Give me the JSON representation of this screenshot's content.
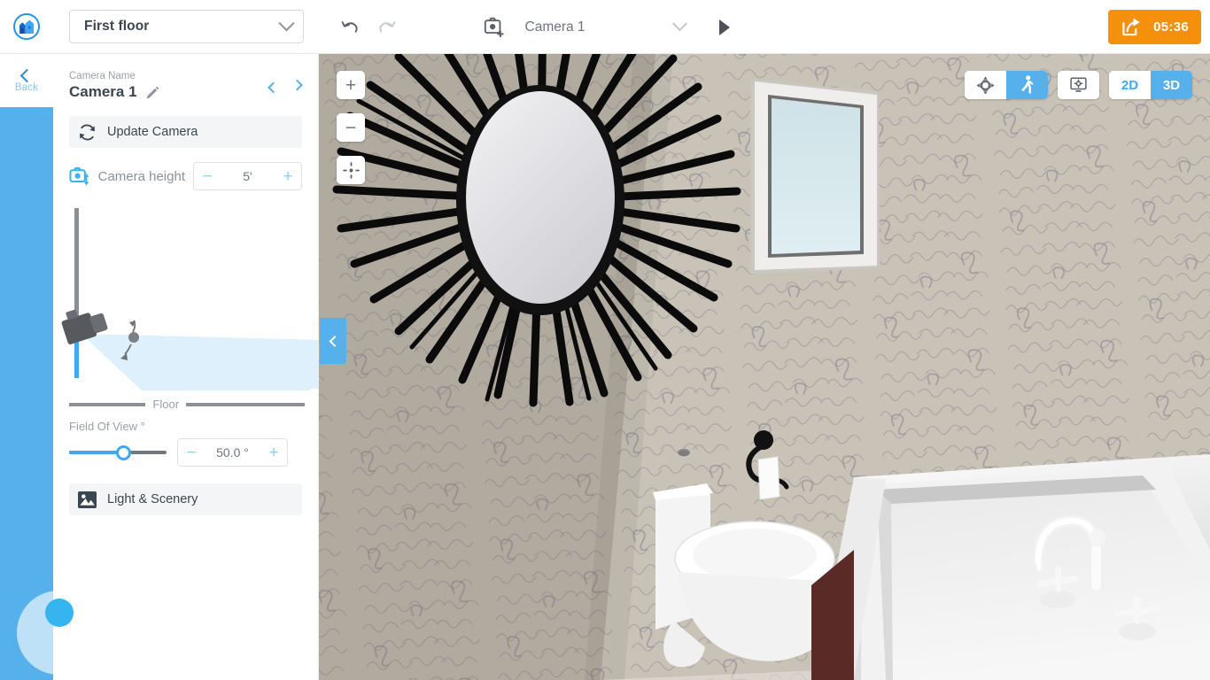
{
  "app": {
    "logo_icon": "house-logo-icon",
    "accent_blue": "#55b0ec",
    "accent_orange": "#f5900c",
    "text_dark": "#3c4651",
    "text_muted": "#9aa1a8"
  },
  "topbar": {
    "floor_select": {
      "value": "First floor",
      "icon": "chevron-down-icon"
    },
    "undo": {
      "label": "Undo",
      "icon": "undo-icon"
    },
    "redo": {
      "label": "Redo",
      "icon": "redo-icon"
    },
    "camera": {
      "add_icon": "camera-add-icon",
      "name": "Camera 1",
      "dropdown_icon": "chevron-down-icon",
      "play_icon": "play-icon"
    },
    "timer": {
      "value": "05:36",
      "icon": "share-export-icon"
    }
  },
  "rail": {
    "back": {
      "label": "Back",
      "icon": "chevron-left-icon"
    }
  },
  "panel": {
    "kicker": "Camera Name",
    "title": "Camera 1",
    "edit_icon": "pencil-icon",
    "prev_icon": "chevron-left-icon",
    "next_icon": "chevron-right-icon",
    "update_camera": {
      "label": "Update Camera",
      "icon": "refresh-icon"
    },
    "camera_height": {
      "label": "Camera height",
      "icon": "camera-height-icon",
      "value": "5'",
      "minus": "−",
      "plus": "+"
    },
    "diagram": {
      "floor_label": "Floor",
      "camera_icon": "camera-icon",
      "rotate_handle_icon": "rotate-handle-icon",
      "cone_color": "#ddf0fb",
      "track_color": "#8b9096",
      "track_fill_color": "#3fa9f5"
    },
    "fov": {
      "label": "Field Of View °",
      "value": "50.0 °",
      "minus": "−",
      "plus": "+",
      "slider_percent": 55
    },
    "light_scenery": {
      "label": "Light & Scenery",
      "icon": "image-icon"
    }
  },
  "viewport": {
    "collapse_icon": "chevron-left-icon",
    "zoom_in": {
      "label": "+",
      "icon": "plus-icon"
    },
    "zoom_out": {
      "label": "−",
      "icon": "minus-icon"
    },
    "recenter": {
      "icon": "target-icon"
    },
    "modes": [
      {
        "name": "orbit",
        "icon": "orbit-icon",
        "active": false
      },
      {
        "name": "walk",
        "icon": "walk-icon",
        "active": true
      }
    ],
    "display_settings": {
      "icon": "monitor-gear-icon",
      "active": false
    },
    "dimension_toggle": [
      {
        "label": "2D",
        "active": false
      },
      {
        "label": "3D",
        "active": true
      }
    ],
    "joystick": {
      "icon": "navigation-joystick"
    },
    "scene": {
      "description": "3D bathroom interior render",
      "wall_color": "#c6c0b4",
      "objects": [
        "sunburst-mirror",
        "window",
        "toilet",
        "toilet-paper-holder",
        "vanity-sink",
        "faucet"
      ]
    }
  }
}
